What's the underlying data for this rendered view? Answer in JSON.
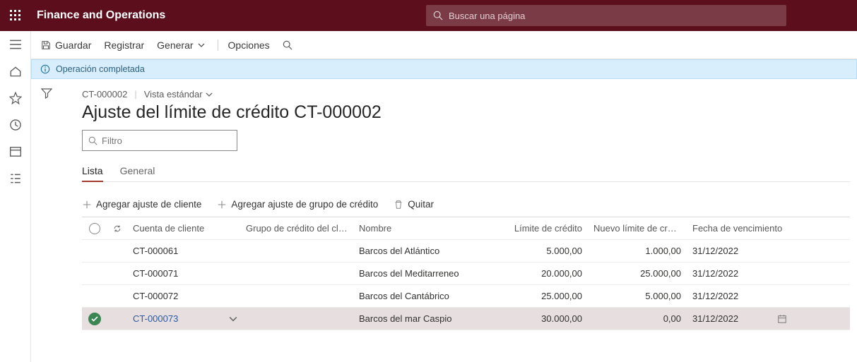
{
  "app": {
    "title": "Finance and Operations"
  },
  "search": {
    "placeholder": "Buscar una página"
  },
  "cmdbar": {
    "save": "Guardar",
    "register": "Registrar",
    "generate": "Generar",
    "options": "Opciones"
  },
  "notification": {
    "text": "Operación completada"
  },
  "breadcrumb": {
    "id": "CT-000002",
    "view": "Vista estándar"
  },
  "page_title": "Ajuste del límite de crédito CT-000002",
  "filter": {
    "placeholder": "Filtro"
  },
  "tabs": {
    "list": "Lista",
    "general": "General"
  },
  "rowactions": {
    "add_cust": "Agregar ajuste de cliente",
    "add_group": "Agregar ajuste de grupo de crédito",
    "remove": "Quitar"
  },
  "columns": {
    "account": "Cuenta de cliente",
    "group": "Grupo de crédito del cliente",
    "name": "Nombre",
    "limit": "Límite de crédito",
    "newlimit": "Nuevo límite de crédito",
    "expiry": "Fecha de vencimiento"
  },
  "rows": [
    {
      "account": "CT-000061",
      "group": "",
      "name": "Barcos del Atlántico",
      "limit": "5.000,00",
      "newlimit": "1.000,00",
      "expiry": "31/12/2022"
    },
    {
      "account": "CT-000071",
      "group": "",
      "name": "Barcos del Meditarreneo",
      "limit": "20.000,00",
      "newlimit": "25.000,00",
      "expiry": "31/12/2022"
    },
    {
      "account": "CT-000072",
      "group": "",
      "name": "Barcos del Cantábrico",
      "limit": "25.000,00",
      "newlimit": "5.000,00",
      "expiry": "31/12/2022"
    },
    {
      "account": "CT-000073",
      "group": "",
      "name": "Barcos del mar Caspio",
      "limit": "30.000,00",
      "newlimit": "0,00",
      "expiry": "31/12/2022"
    }
  ]
}
